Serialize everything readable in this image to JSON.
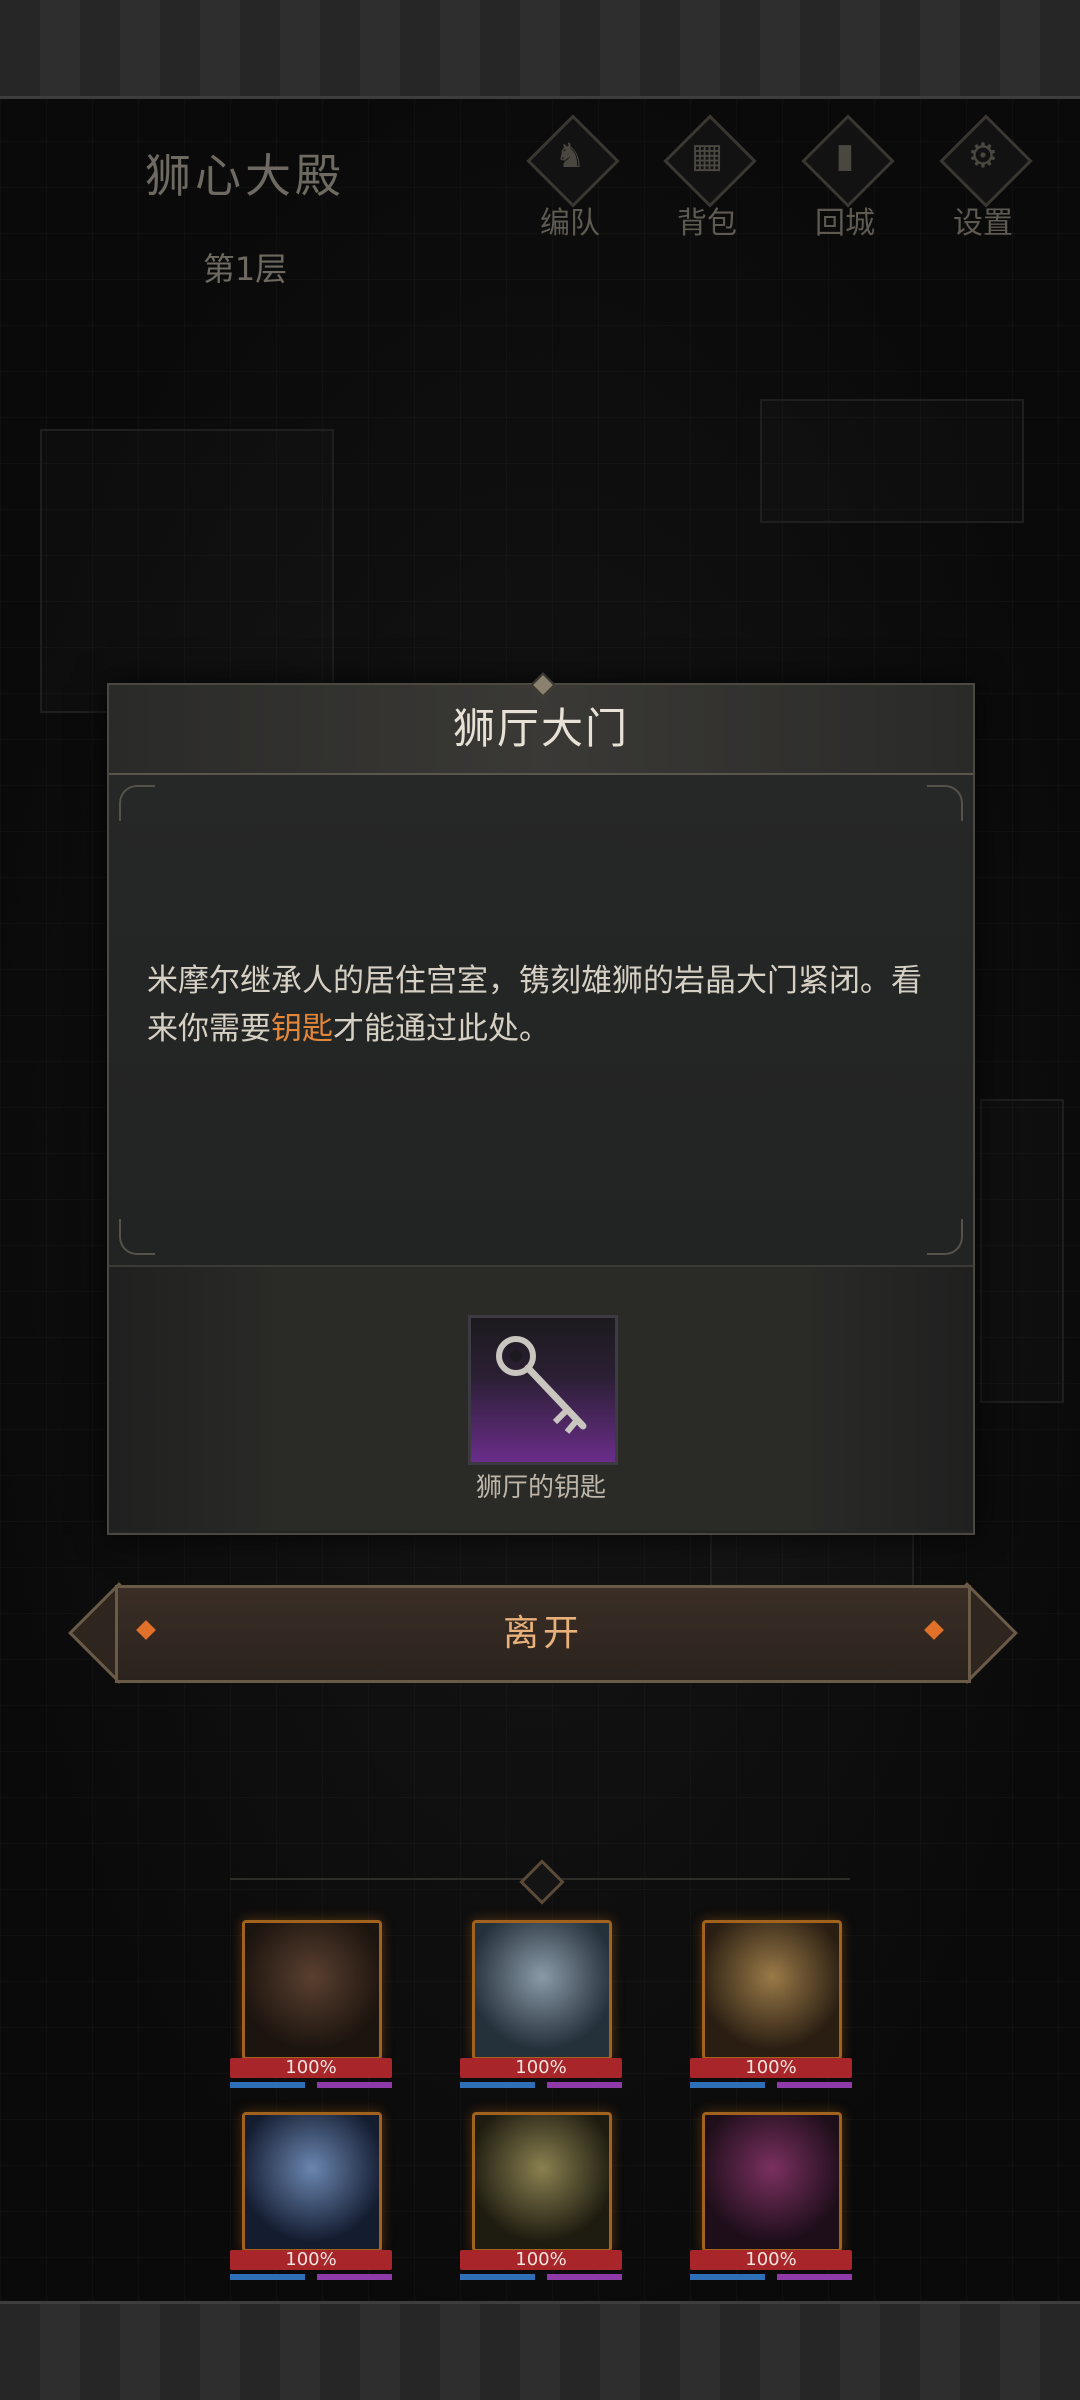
{
  "location": {
    "name": "狮心大殿",
    "floor": "第1层"
  },
  "topnav": [
    {
      "label": "编队",
      "icon": "helmet-icon",
      "glyph": "♞"
    },
    {
      "label": "背包",
      "icon": "backpack-icon",
      "glyph": "▦"
    },
    {
      "label": "回城",
      "icon": "door-exit-icon",
      "glyph": "▮"
    },
    {
      "label": "设置",
      "icon": "gear-icon",
      "glyph": "⚙"
    }
  ],
  "dialog": {
    "title": "狮厅大门",
    "description_before": "米摩尔继承人的居住宫室，镌刻雄狮的岩晶大门紧闭。看来你需要",
    "description_highlight": "钥匙",
    "description_after": "才能通过此处。",
    "highlight_color": "#e2863a",
    "item": {
      "name": "狮厅的钥匙",
      "icon": "key-icon",
      "rarity_color": "#6a2d8a"
    }
  },
  "leave_button": {
    "label": "离开"
  },
  "party": [
    {
      "hp_text": "100%",
      "hp": 1.0
    },
    {
      "hp_text": "100%",
      "hp": 1.0
    },
    {
      "hp_text": "100%",
      "hp": 1.0
    },
    {
      "hp_text": "100%",
      "hp": 1.0
    },
    {
      "hp_text": "100%",
      "hp": 1.0
    },
    {
      "hp_text": "100%",
      "hp": 1.0
    }
  ]
}
